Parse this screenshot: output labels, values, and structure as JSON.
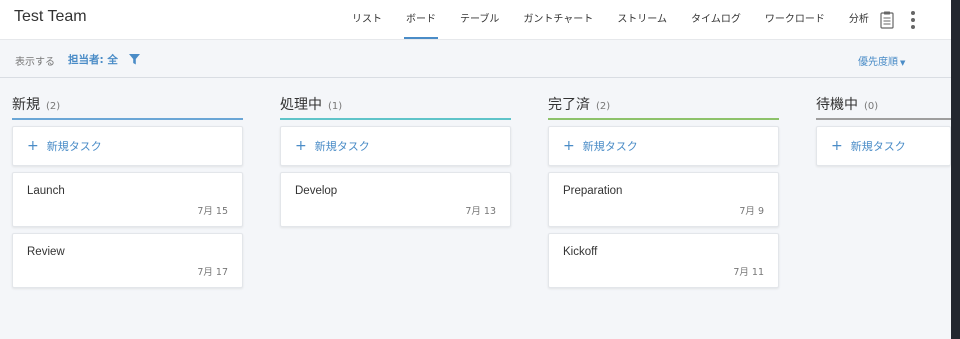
{
  "header": {
    "team_name": "Test Team",
    "tabs": [
      {
        "label": "リスト",
        "active": false
      },
      {
        "label": "ボード",
        "active": true
      },
      {
        "label": "テーブル",
        "active": false
      },
      {
        "label": "ガントチャート",
        "active": false
      },
      {
        "label": "ストリーム",
        "active": false
      },
      {
        "label": "タイムログ",
        "active": false
      },
      {
        "label": "ワークロード",
        "active": false
      },
      {
        "label": "分析",
        "active": false
      }
    ],
    "icons": [
      "clipboard-icon",
      "more-vertical-icon"
    ]
  },
  "filterbar": {
    "display_label": "表示する",
    "assignee_filter": "担当者: 全",
    "sort_label": "優先度順"
  },
  "colors": {
    "accent": "#4a8cc7",
    "new_column": "#6aa6d6",
    "in_progress_column": "#5fc4c9",
    "done_column": "#8dc26a",
    "waiting_column": "#9e9e9e"
  },
  "columns": [
    {
      "title": "新規",
      "count": "(2)",
      "new_task_label": "新規タスク",
      "cards": [
        {
          "title": "Launch",
          "date": "7月 15"
        },
        {
          "title": "Review",
          "date": "7月 17"
        }
      ]
    },
    {
      "title": "処理中",
      "count": "(1)",
      "new_task_label": "新規タスク",
      "cards": [
        {
          "title": "Develop",
          "date": "7月 13"
        }
      ]
    },
    {
      "title": "完了済",
      "count": "(2)",
      "new_task_label": "新規タスク",
      "cards": [
        {
          "title": "Preparation",
          "date": "7月 9"
        },
        {
          "title": "Kickoff",
          "date": "7月 11"
        }
      ]
    },
    {
      "title": "待機中",
      "count": "(0)",
      "new_task_label": "新規タスク",
      "cards": []
    }
  ]
}
